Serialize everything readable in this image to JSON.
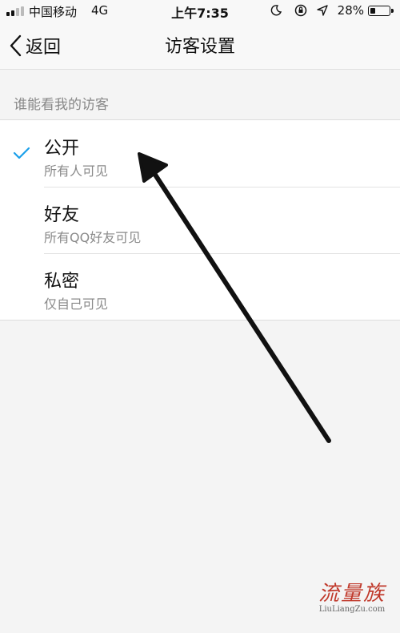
{
  "status_bar": {
    "carrier": "中国移动",
    "network": "4G",
    "time": "上午7:35",
    "battery_percent": "28%",
    "battery_level": 0.28,
    "icons": [
      "signal-icon",
      "moon-icon",
      "rotation-lock-icon",
      "location-arrow-icon",
      "battery-icon"
    ]
  },
  "nav": {
    "back_label": "返回",
    "title": "访客设置"
  },
  "section": {
    "header": "谁能看我的访客"
  },
  "options": [
    {
      "title": "公开",
      "subtitle": "所有人可见",
      "selected": true
    },
    {
      "title": "好友",
      "subtitle": "所有QQ好友可见",
      "selected": false
    },
    {
      "title": "私密",
      "subtitle": "仅自己可见",
      "selected": false
    }
  ],
  "watermark": {
    "logo_text": "流量族",
    "url": "LiuLiangZu.com"
  },
  "colors": {
    "check": "#1a9fea",
    "background": "#f4f4f4",
    "watermark": "#c0392b"
  }
}
